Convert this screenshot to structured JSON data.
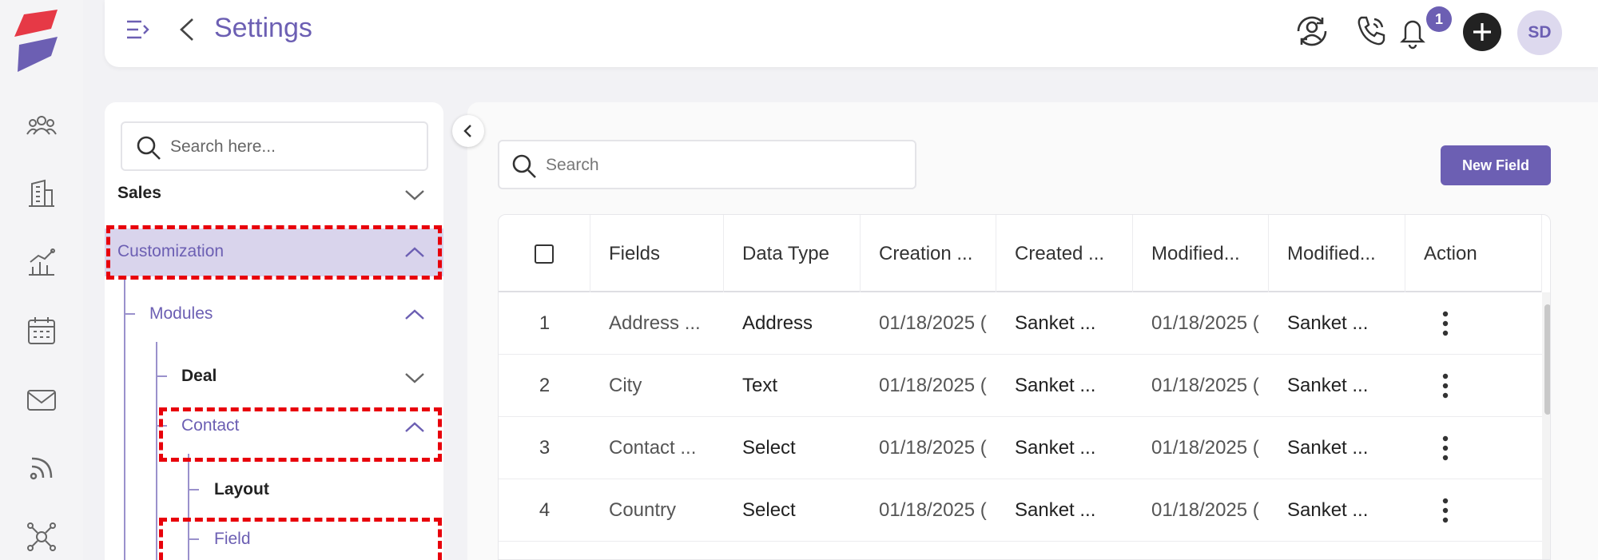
{
  "header": {
    "title": "Settings",
    "notification_count": "1",
    "avatar_initials": "SD"
  },
  "colors": {
    "accent": "#6c5fb3",
    "highlight": "#d9d4ec",
    "annotation": "#e8000b",
    "logo_red": "#e63946"
  },
  "rail": {
    "icons": [
      "contacts-icon",
      "companies-icon",
      "deals-icon",
      "calendar-icon",
      "mail-icon",
      "feeds-icon",
      "integrations-icon"
    ]
  },
  "tree": {
    "search_placeholder": "Search here...",
    "items": {
      "sales": "Sales",
      "customization": "Customization",
      "modules": "Modules",
      "deal": "Deal",
      "contact": "Contact",
      "layout": "Layout",
      "field": "Field"
    }
  },
  "main": {
    "search_placeholder": "Search",
    "new_field_label": "New Field",
    "columns": [
      "Fields",
      "Data Type",
      "Creation ...",
      "Created ...",
      "Modified...",
      "Modified...",
      "Action"
    ],
    "rows": [
      {
        "index": "1",
        "field": "Address ...",
        "type": "Address",
        "created_on": "01/18/2025 (",
        "created_by": "Sanket ...",
        "modified_on": "01/18/2025 (",
        "modified_by": "Sanket ..."
      },
      {
        "index": "2",
        "field": "City",
        "type": "Text",
        "created_on": "01/18/2025 (",
        "created_by": "Sanket ...",
        "modified_on": "01/18/2025 (",
        "modified_by": "Sanket ..."
      },
      {
        "index": "3",
        "field": "Contact ...",
        "type": "Select",
        "created_on": "01/18/2025 (",
        "created_by": "Sanket ...",
        "modified_on": "01/18/2025 (",
        "modified_by": "Sanket ..."
      },
      {
        "index": "4",
        "field": "Country",
        "type": "Select",
        "created_on": "01/18/2025 (",
        "created_by": "Sanket ...",
        "modified_on": "01/18/2025 (",
        "modified_by": "Sanket ..."
      }
    ]
  }
}
